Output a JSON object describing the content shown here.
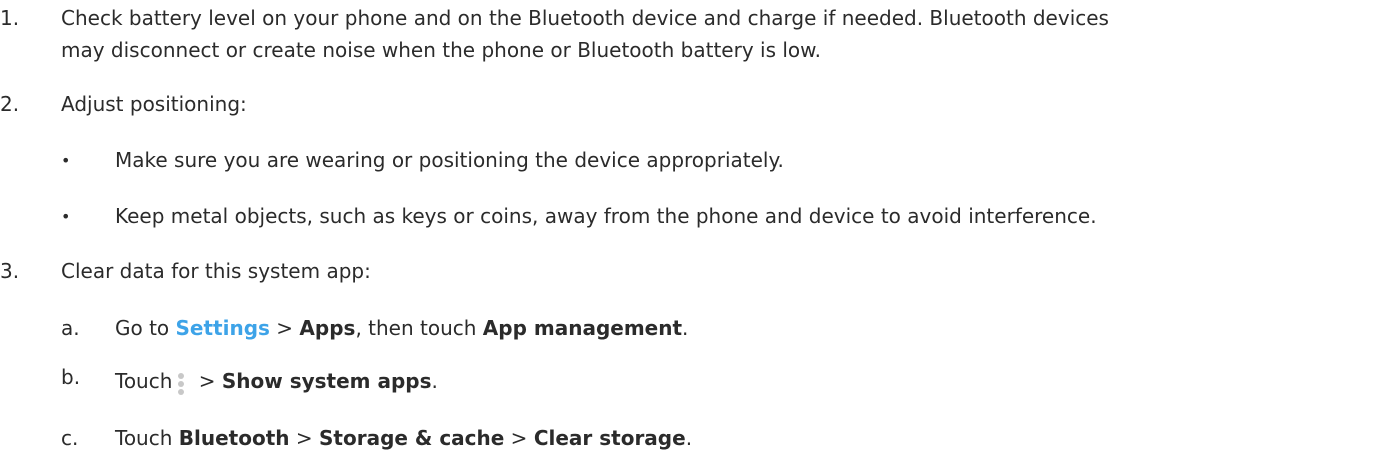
{
  "steps": [
    {
      "num": "1.",
      "line1": "Check battery level on your phone and on the Bluetooth device and charge if needed. Bluetooth devices",
      "line2": "may disconnect or create noise when the phone or Bluetooth battery is low."
    },
    {
      "num": "2.",
      "text": "Adjust positioning:",
      "bullets": [
        "Make sure you are wearing or positioning the device appropriately.",
        "Keep metal objects, such as keys or coins, away from the phone and device to avoid interference."
      ],
      "bullet_glyph": "•"
    },
    {
      "num": "3.",
      "text": "Clear data for this system app:",
      "substeps": [
        {
          "letter": "a.",
          "go_to": "Go to ",
          "settings": "Settings",
          "sep": " > ",
          "apps": "Apps",
          "then": ", then touch ",
          "app_management": "App management",
          "end": "."
        },
        {
          "letter": "b.",
          "touch": "Touch",
          "sep": " > ",
          "show_system_apps": "Show system apps",
          "end": "."
        },
        {
          "letter": "c.",
          "touch": "Touch ",
          "bluetooth": "Bluetooth",
          "sep1": " > ",
          "storage_cache": "Storage & cache",
          "sep2": " > ",
          "clear_storage": "Clear storage",
          "end": "."
        }
      ]
    }
  ],
  "colors": {
    "text": "#2b2b2b",
    "link": "#3da3e8",
    "menu_icon": "#c8c8c8"
  },
  "icons": {
    "overflow_menu": "more-vert-icon"
  }
}
